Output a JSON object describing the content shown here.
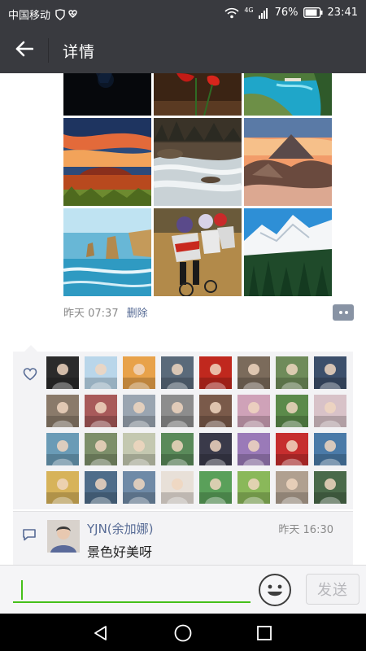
{
  "status_bar": {
    "carrier": "中国移动",
    "network": "4G",
    "battery": "76%",
    "time": "23:41"
  },
  "app_bar": {
    "title": "详情",
    "back_icon": "arrow-left-icon"
  },
  "moment": {
    "time": "昨天 07:37",
    "delete_label": "删除",
    "more_icon": "more-dots-icon",
    "photos": [
      {
        "name": "photo-dark-night"
      },
      {
        "name": "photo-red-flowers"
      },
      {
        "name": "photo-turquoise-bay"
      },
      {
        "name": "photo-uluru-sunset"
      },
      {
        "name": "photo-river-rapids"
      },
      {
        "name": "photo-volcano-dawn"
      },
      {
        "name": "photo-sea-stacks"
      },
      {
        "name": "photo-cyclists"
      },
      {
        "name": "photo-snowy-mountains"
      }
    ]
  },
  "likes": {
    "icon": "heart-icon",
    "avatars": [
      "#2b2b2b",
      "#b9d6ea",
      "#e8a24a",
      "#5a6a7a",
      "#c0281e",
      "#7b6b5b",
      "#6f8b5a",
      "#3c4f6b",
      "#8a7a6a",
      "#a85a5a",
      "#9aa5b1",
      "#8d8d8d",
      "#7a5a4a",
      "#cfa2b8",
      "#5b8a4a",
      "#d8c2c8",
      "#6a9bb6",
      "#7d8f6a",
      "#c4c8b0",
      "#5a8a5a",
      "#3a3a4a",
      "#9a7ab8",
      "#c62e2e",
      "#4a7aa8",
      "#d7b35a",
      "#4f6d8a",
      "#6f8aa7",
      "#e8e0d8",
      "#5aa05a",
      "#8ab85a",
      "#b0a090",
      "#4a6a4a"
    ]
  },
  "comments": [
    {
      "icon": "comment-icon",
      "name": "YJN(余加娜)",
      "time": "昨天 16:30",
      "text": "景色好美呀"
    }
  ],
  "input_bar": {
    "placeholder": "",
    "emoji_icon": "smiley-icon",
    "send_label": "发送"
  },
  "nav_bar": {
    "back_icon": "triangle-back-icon",
    "home_icon": "circle-home-icon",
    "recents_icon": "square-recents-icon"
  },
  "colors": {
    "header": "#393a3f",
    "link": "#576b95",
    "accent_green": "#45c01a",
    "panel": "#f3f3f5"
  }
}
